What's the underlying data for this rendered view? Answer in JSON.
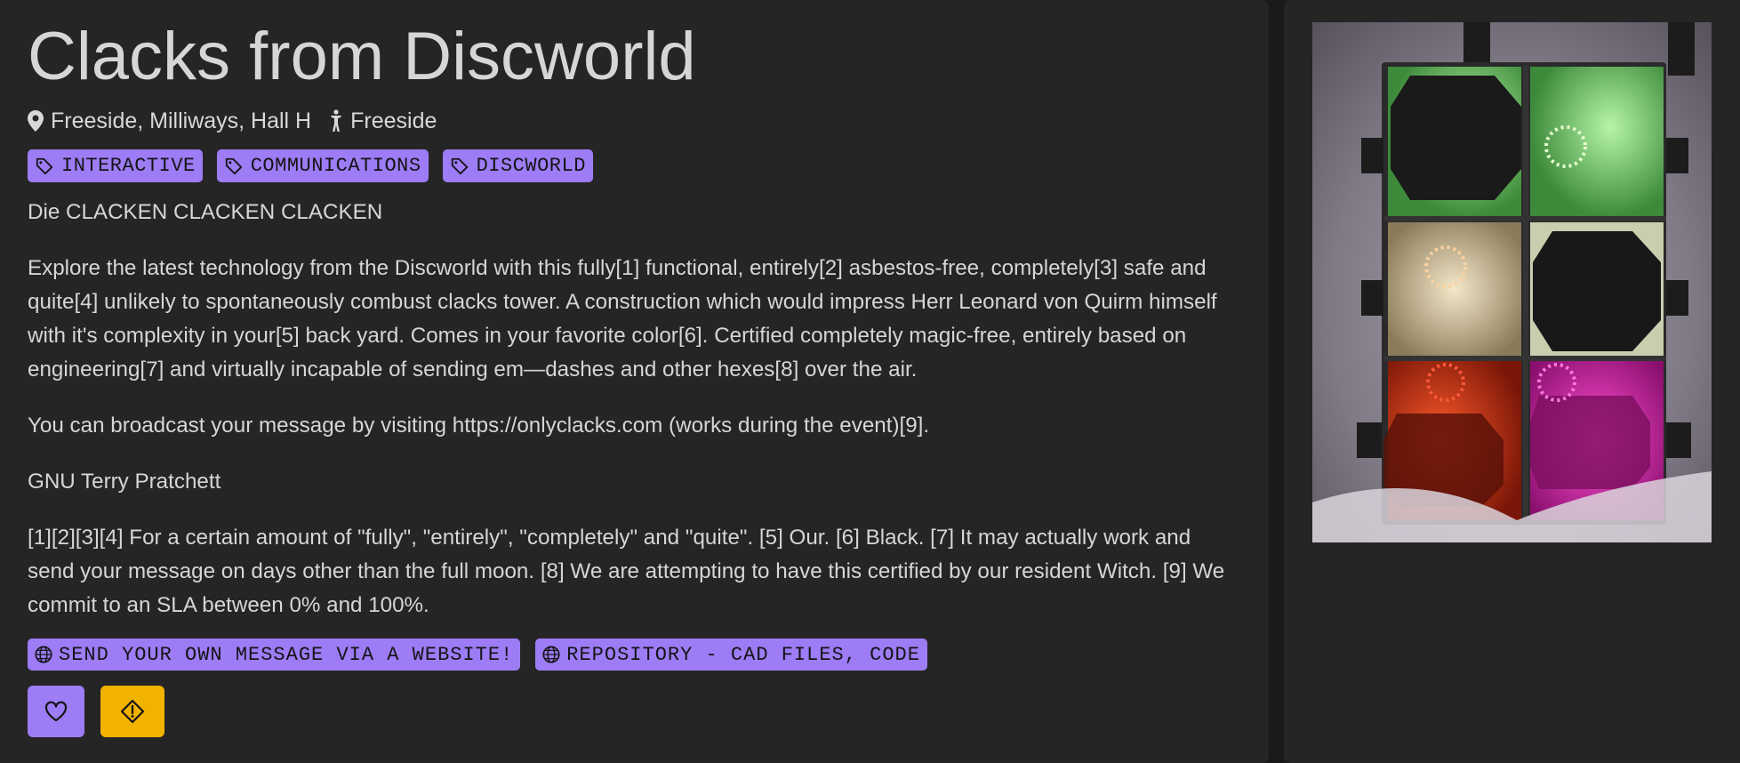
{
  "project": {
    "title": "Clacks from Discworld",
    "location": "Freeside, Milliways, Hall H",
    "area": "Freeside",
    "tags": [
      "INTERACTIVE",
      "COMMUNICATIONS",
      "DISCWORLD"
    ],
    "subtitle": "Die CLACKEN CLACKEN CLACKEN",
    "description": "Explore the latest technology from the Discworld with this fully[1] functional, entirely[2] asbestos-free, completely[3] safe and quite[4] unlikely to spontaneously combust clacks tower. A construction which would impress Herr Leonard von Quirm himself with it's complexity in your[5] back yard. Comes in your favorite color[6]. Certified completely magic-free, entirely based on engineering[7] and virtually incapable of sending em—dashes and other hexes[8] over the air.",
    "broadcast": "You can broadcast your message by visiting https://onlyclacks.com (works during the event)[9].",
    "author": "GNU Terry Pratchett",
    "footnotes": "[1][2][3][4] For a certain amount of \"fully\", \"entirely\", \"completely\" and \"quite\". [5] Our. [6] Black. [7] It may actually work and send your message on days other than the full moon. [8] We are attempting to have this certified by our resident Witch. [9] We commit to an SLA between 0% and 100%.",
    "links": [
      {
        "label": "SEND YOUR OWN MESSAGE VIA A WEBSITE!",
        "icon": "globe-icon"
      },
      {
        "label": "REPOSITORY - CAD FILES, CODE",
        "icon": "globe-icon"
      }
    ]
  },
  "icons": {
    "location": "map-pin-icon",
    "area": "person-icon",
    "tag": "tag-icon",
    "like": "heart-icon",
    "report": "warning-diamond-icon"
  },
  "colors": {
    "accent": "#9d7cf6",
    "warning": "#f2b200",
    "background": "#1a1a1a",
    "card": "#252525"
  }
}
